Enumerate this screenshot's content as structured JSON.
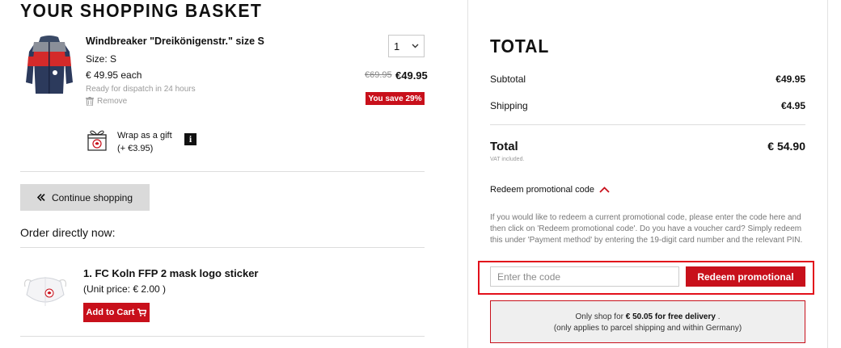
{
  "page": {
    "title": "YOUR SHOPPING BASKET"
  },
  "item": {
    "name": "Windbreaker \"Dreikönigenstr.\" size S",
    "size": "Size: S",
    "each_price": "€ 49.95 each",
    "dispatch": "Ready for dispatch in 24 hours",
    "remove": "Remove",
    "quantity": "1",
    "old_price": "€69.95",
    "new_price": "€49.95",
    "save_badge": "You save 29%"
  },
  "gift": {
    "label": "Wrap as a gift",
    "price": "(+ €3.95)",
    "info": "i"
  },
  "continue_shopping": "Continue shopping",
  "order_direct": "Order directly now:",
  "suggestion": {
    "name": "1. FC Koln FFP 2 mask logo sticker",
    "price": "(Unit price: € 2.00 )",
    "cart_button": "Add to Cart"
  },
  "summary": {
    "title": "TOTAL",
    "subtotal_label": "Subtotal",
    "subtotal_value": "€49.95",
    "shipping_label": "Shipping",
    "shipping_value": "€4.95",
    "total_label": "Total",
    "total_value": "€ 54.90",
    "vat_note": "VAT included."
  },
  "promo": {
    "toggle_label": "Redeem promotional code",
    "help_text": "If you would like to redeem a current promotional code, please enter the code here and then click on 'Redeem promotional code'. Do you have a voucher card? Simply redeem this under 'Payment method' by entering the 19-digit card number and the relevant PIN.",
    "placeholder": "Enter the code",
    "button": "Redeem promotional"
  },
  "delivery": {
    "prefix": "Only shop for ",
    "amount": "€ 50.05 for free delivery",
    "suffix": " .",
    "note": "(only applies to parcel shipping and within Germany)"
  },
  "colors": {
    "accent": "#c8101b",
    "highlight_border": "#e2101b"
  }
}
